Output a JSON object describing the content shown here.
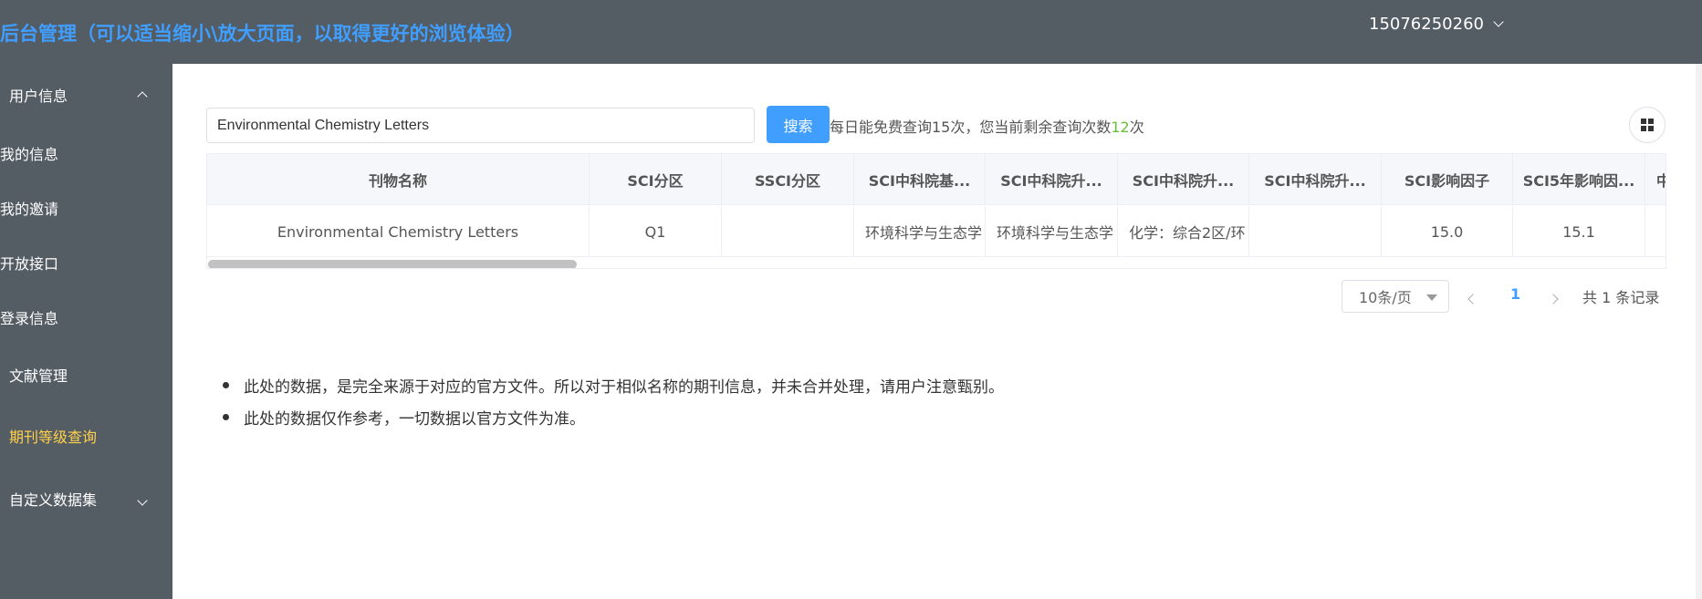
{
  "header": {
    "title": "后台管理（可以适当缩小\\放大页面，以取得更好的浏览体验）",
    "user": "15076250260"
  },
  "sidebar": {
    "items": [
      {
        "label": "用户信息",
        "arrow": "up"
      },
      {
        "label": "我的信息"
      },
      {
        "label": "我的邀请"
      },
      {
        "label": "开放接口"
      },
      {
        "label": "登录信息"
      },
      {
        "label": "文献管理"
      },
      {
        "label": "期刊等级查询",
        "active": true
      },
      {
        "label": "自定义数据集",
        "arrow": "down"
      }
    ]
  },
  "search": {
    "value": "Environmental Chemistry Letters",
    "button_label": "搜索",
    "quota_prefix": "每日能免费查询15次，您当前剩余查询次数",
    "quota_remaining": "12",
    "quota_suffix": "次"
  },
  "table": {
    "columns": [
      "刊物名称",
      "SCI分区",
      "SSCI分区",
      "SCI中科院基...",
      "SCI中科院升...",
      "SCI中科院升...",
      "SCI中科院升...",
      "SCI影响因子",
      "SCI5年影响因...",
      "中"
    ],
    "rows": [
      [
        "Environmental Chemistry Letters",
        "Q1",
        "",
        "环境科学与生态学",
        "环境科学与生态学",
        "化学：综合2区/环",
        "",
        "15.0",
        "15.1",
        ""
      ]
    ]
  },
  "pagination": {
    "page_size": "10条/页",
    "current_page": "1",
    "total": "共 1 条记录"
  },
  "notes": [
    "此处的数据，是完全来源于对应的官方文件。所以对于相似名称的期刊信息，并未合并处理，请用户注意甄别。",
    "此处的数据仅作参考，一切数据以官方文件为准。"
  ],
  "colors": {
    "header_bg": "#545c64",
    "accent": "#409eff",
    "active_menu": "#ffd04b",
    "quota_highlight": "#67c23a"
  }
}
